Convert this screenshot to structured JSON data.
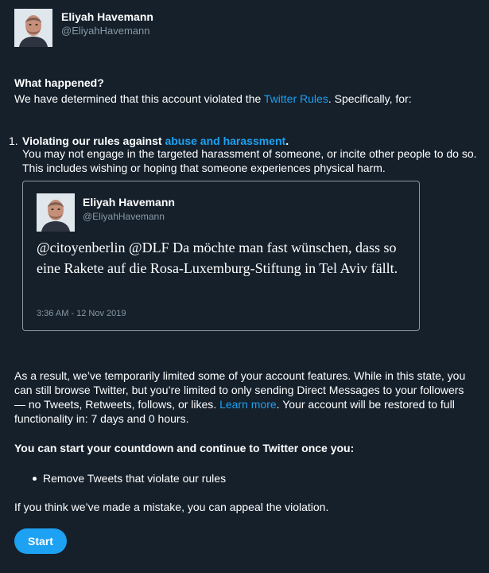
{
  "header": {
    "name": "Eliyah Havemann",
    "handle": "@EliyahHavemann"
  },
  "what_happened": {
    "heading": "What happened?",
    "intro_before": "We have determined that this account violated the ",
    "rules_link": "Twitter Rules",
    "intro_after": ". Specifically, for:"
  },
  "violation": {
    "number": "1.",
    "title_prefix": "Violating our rules against ",
    "title_link": "abuse and harassment",
    "title_suffix": ".",
    "description": "You may not engage in the targeted harassment of someone, or incite other people to do so. This includes wishing or hoping that someone experiences physical harm."
  },
  "tweet": {
    "name": "Eliyah Havemann",
    "handle": "@EliyahHavemann",
    "text": "@citoyenberlin @DLF Da möchte man fast wünschen, dass so eine Rakete auf die Rosa-Luxemburg-Stiftung in Tel Aviv fällt.",
    "timestamp": "3:36 AM - 12 Nov 2019"
  },
  "result": {
    "text_before": "As a result, we’ve temporarily limited some of your account features. While in this state, you can still browse Twitter, but you’re limited to only sending Direct Messages to your followers — no Tweets, Retweets, follows, or likes. ",
    "learn_more": "Learn more",
    "text_after": ". Your account will be restored to full functionality in: 7 days and 0 hours."
  },
  "countdown": {
    "heading": "You can start your countdown and continue to Twitter once you:",
    "items": [
      "Remove Tweets that violate our rules"
    ]
  },
  "appeal_text": "If you think we’ve made a mistake, you can appeal the violation.",
  "start_button": "Start",
  "colors": {
    "background": "#15202b",
    "link": "#1da1f2",
    "muted": "#8899a6",
    "button": "#1da1f2"
  }
}
